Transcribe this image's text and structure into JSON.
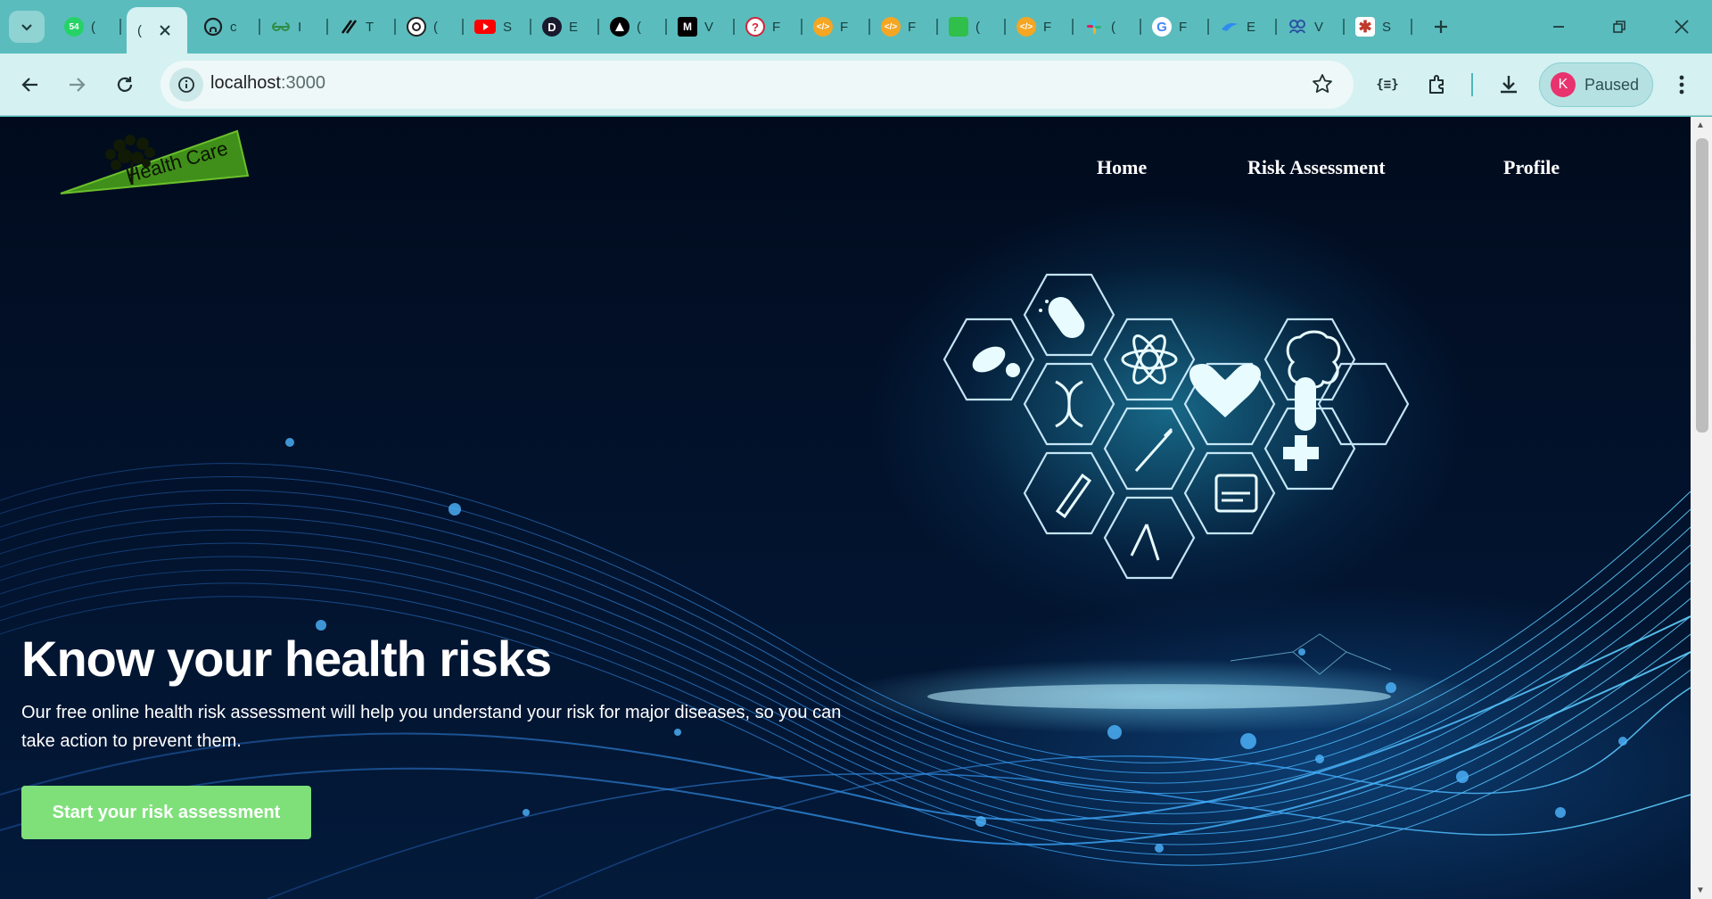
{
  "browser": {
    "tabs": [
      {
        "favicon": "whatsapp-icon",
        "badge": "54",
        "title": "("
      },
      {
        "favicon": "blank-page-icon",
        "title": "(",
        "active": true
      },
      {
        "favicon": "github-icon",
        "title": "c"
      },
      {
        "favicon": "geeksforgeeks-icon",
        "title": "I"
      },
      {
        "favicon": "slash-icon",
        "title": "T"
      },
      {
        "favicon": "chatgpt-icon",
        "title": "("
      },
      {
        "favicon": "youtube-icon",
        "title": "S"
      },
      {
        "favicon": "d-letter-icon",
        "title": "E"
      },
      {
        "favicon": "triangle-icon",
        "title": "("
      },
      {
        "favicon": "medium-icon",
        "title": "V"
      },
      {
        "favicon": "question-icon",
        "title": "F"
      },
      {
        "favicon": "code-orange-icon",
        "title": "F"
      },
      {
        "favicon": "code-orange-icon",
        "title": "F"
      },
      {
        "favicon": "green-app-icon",
        "title": "("
      },
      {
        "favicon": "code-orange-icon",
        "title": "F"
      },
      {
        "favicon": "slack-icon",
        "title": "("
      },
      {
        "favicon": "google-icon",
        "title": "F"
      },
      {
        "favicon": "blue-wing-icon",
        "title": "E"
      },
      {
        "favicon": "people-icon",
        "title": "V"
      },
      {
        "favicon": "asterisk-icon",
        "title": "S"
      }
    ],
    "address": {
      "host": "localhost",
      "port": ":3000"
    },
    "profile": {
      "initial": "K",
      "status": "Paused"
    }
  },
  "page": {
    "logo_text": "Health Care",
    "nav": {
      "home": "Home",
      "risk": "Risk Assessment",
      "profile": "Profile"
    },
    "hero": {
      "title": "Know your health risks",
      "description": "Our free online health risk assessment will help you understand your risk for major diseases, so you can take action to prevent them.",
      "cta": "Start your risk assessment"
    }
  },
  "colors": {
    "accent": "#7fe07a",
    "tabstrip": "#5bbcbd",
    "toolbar": "#d5f1f2",
    "page_bg": "#02112a"
  }
}
